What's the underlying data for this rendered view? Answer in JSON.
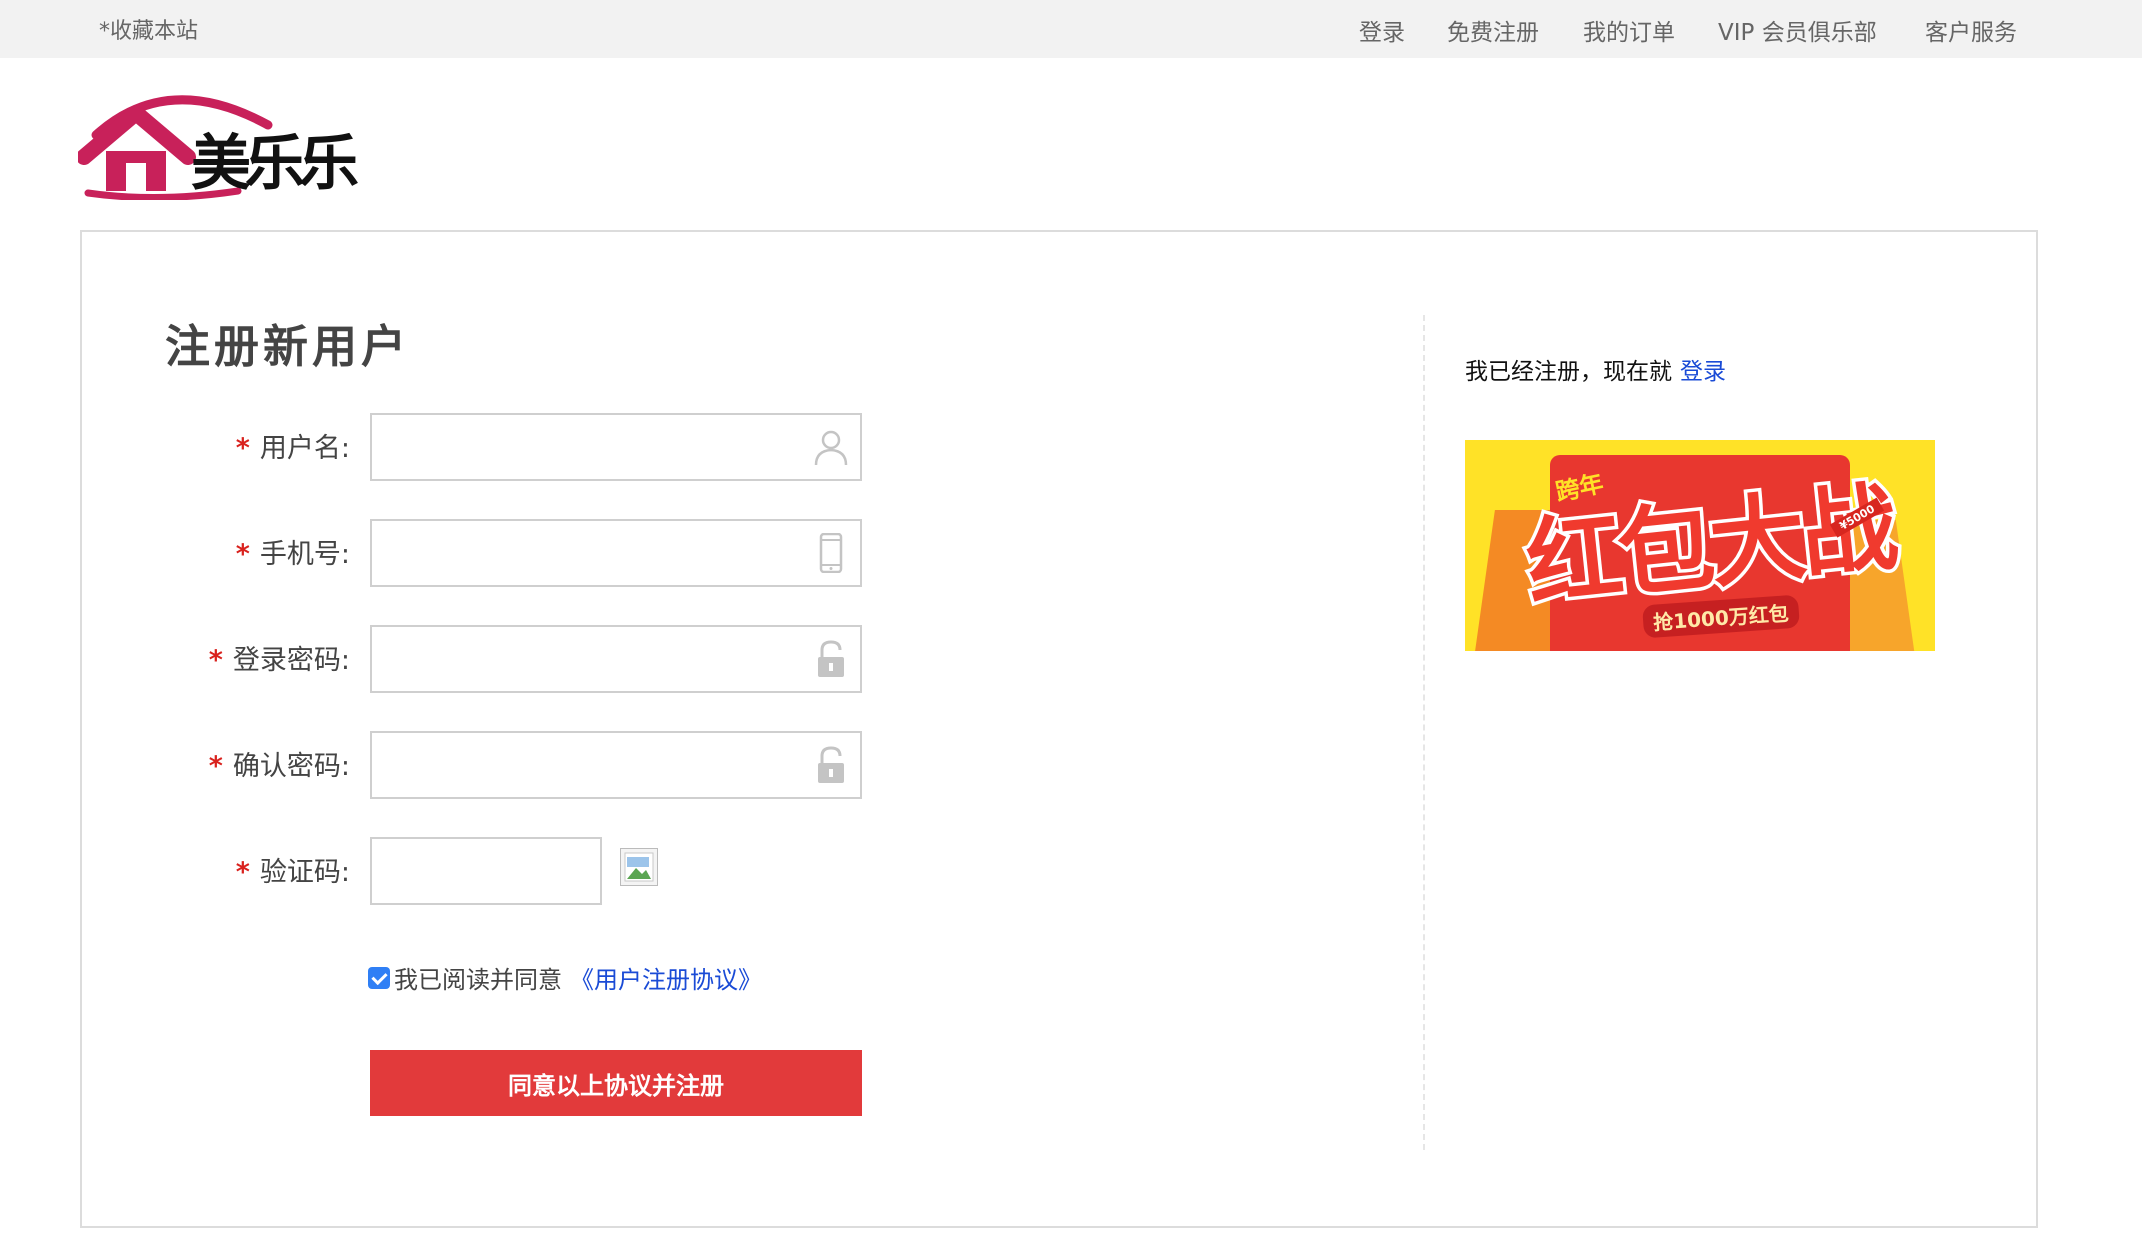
{
  "topbar": {
    "favorite": "*收藏本站",
    "nav": [
      "登录",
      "免费注册",
      "我的订单",
      "VIP 会员俱乐部",
      "客户服务"
    ]
  },
  "logo": {
    "text": "美乐乐"
  },
  "form": {
    "title": "注册新用户",
    "fields": {
      "username": {
        "label": "用户名:",
        "value": "",
        "placeholder": ""
      },
      "phone": {
        "label": "手机号:",
        "value": "",
        "placeholder": ""
      },
      "password": {
        "label": "登录密码:",
        "value": "",
        "placeholder": ""
      },
      "confirm": {
        "label": "确认密码:",
        "value": "",
        "placeholder": ""
      },
      "captcha": {
        "label": "验证码:",
        "value": "",
        "placeholder": ""
      }
    },
    "required_mark": "*",
    "agreement": {
      "checked": true,
      "text": "我已阅读并同意",
      "link": "《用户注册协议》"
    },
    "submit_label": "同意以上协议并注册"
  },
  "sidebar": {
    "already_text": "我已经注册，现在就",
    "login_link": "登录",
    "banner": {
      "small": "跨年",
      "title": "红包大战",
      "subtitle": "抢1000万红包",
      "tag": "¥5000"
    }
  },
  "colors": {
    "accent_red": "#e23a3b",
    "link_blue": "#1a4bd6",
    "logo_pink": "#c8215a",
    "checkbox_blue": "#2f7ff5"
  }
}
